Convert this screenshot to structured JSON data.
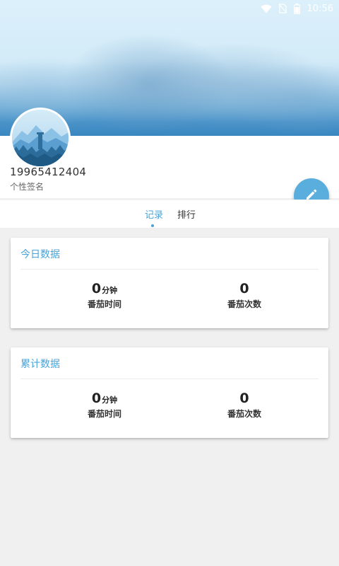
{
  "status_bar": {
    "time": "10:56",
    "icons": [
      "wifi-icon",
      "no-sim-icon",
      "battery-icon"
    ]
  },
  "profile": {
    "username": "19965412404",
    "signature": "个性签名",
    "avatar_icon": "mountain-landscape-avatar"
  },
  "edit_button": {
    "icon": "pencil-icon"
  },
  "tabs": [
    {
      "label": "记录",
      "active": true
    },
    {
      "label": "排行",
      "active": false
    }
  ],
  "today": {
    "title": "今日数据",
    "time_value": "0",
    "time_unit": "分钟",
    "time_label": "番茄时间",
    "count_value": "0",
    "count_label": "番茄次数"
  },
  "total": {
    "title": "累计数据",
    "time_value": "0",
    "time_unit": "分钟",
    "time_label": "番茄时间",
    "count_value": "0",
    "count_label": "番茄次数"
  },
  "colors": {
    "accent": "#4aa3d8",
    "fab": "#5aaede",
    "background": "#f0f0f0"
  }
}
